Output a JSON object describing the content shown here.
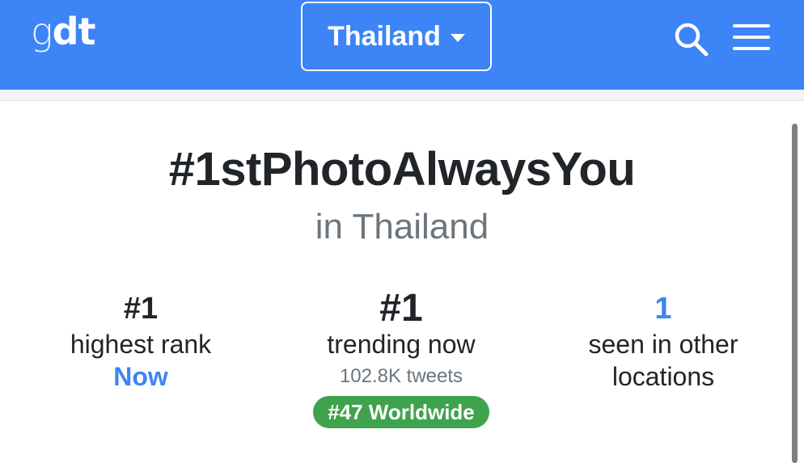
{
  "navbar": {
    "brand_g": "g",
    "brand_dt": "dt",
    "country": "Thailand",
    "icons": {
      "search": "search-icon",
      "menu": "hamburger-menu-icon",
      "dropdown": "caret-down-icon"
    },
    "colors": {
      "navbar": "#3d84f7",
      "badge": "#3fa34d",
      "accent": "#3d84f7"
    }
  },
  "trend": {
    "hashtag": "#1stPhotoAlwaysYou",
    "location": "in Thailand"
  },
  "stats": {
    "highest": {
      "rank": "#1",
      "label": "highest rank",
      "when": "Now"
    },
    "trending": {
      "rank": "#1",
      "label": "trending now",
      "tweets": "102.8K tweets",
      "worldwide": "#47 Worldwide"
    },
    "other": {
      "count": "1",
      "label_line1": "seen in other",
      "label_line2": "locations"
    }
  }
}
